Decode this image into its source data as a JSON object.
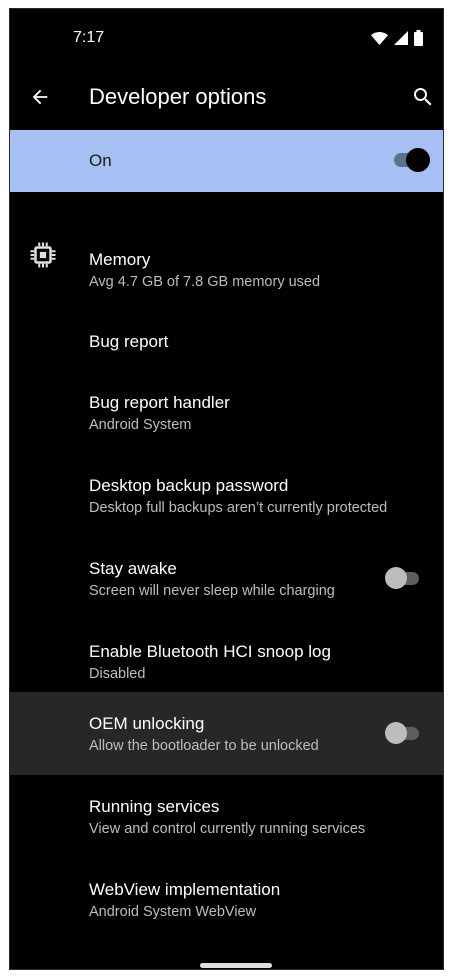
{
  "status_bar": {
    "time": "7:17"
  },
  "app_bar": {
    "title": "Developer options"
  },
  "master_switch": {
    "label": "On",
    "state": "on"
  },
  "items": [
    {
      "title": "Memory",
      "summary": "Avg 4.7 GB of 7.8 GB memory used",
      "icon": "memory-chip-icon"
    },
    {
      "title": "Bug report"
    },
    {
      "title": "Bug report handler",
      "summary": "Android System"
    },
    {
      "title": "Desktop backup password",
      "summary": "Desktop full backups aren’t currently protected"
    },
    {
      "title": "Stay awake",
      "summary": "Screen will never sleep while charging",
      "toggle": "off"
    },
    {
      "title": "Enable Bluetooth HCI snoop log",
      "summary": "Disabled"
    },
    {
      "title": "OEM unlocking",
      "summary": "Allow the bootloader to be unlocked",
      "toggle": "off"
    },
    {
      "title": "Running services",
      "summary": "View and control currently running services"
    },
    {
      "title": "WebView implementation",
      "summary": "Android System WebView"
    }
  ],
  "colors": {
    "background": "#000000",
    "master_bar": "#a6c0f4",
    "highlight_row": "#272727",
    "title_text": "#ffffff",
    "summary_text": "#bdbdbd"
  }
}
